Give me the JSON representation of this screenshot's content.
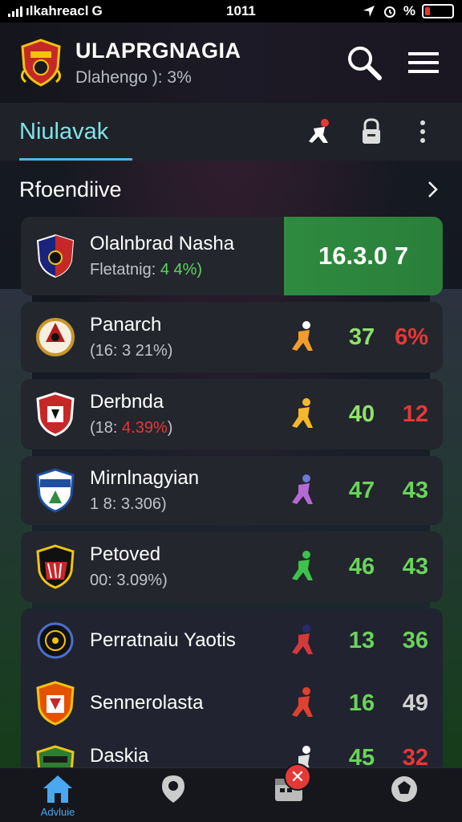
{
  "status_bar": {
    "carrier": "ılkahreacl",
    "network_icon": "G",
    "time": "1011",
    "battery_percent_text": "%",
    "battery_level": 0.2
  },
  "header": {
    "title": "ULAPRGNAGIA",
    "subtitle": "Dlahengo ): 3%",
    "icons": [
      "search-icon",
      "menu-icon"
    ]
  },
  "tab_bar": {
    "active_tab": "Niulavak",
    "icons": [
      "player-icon",
      "lock-icon",
      "more-icon"
    ]
  },
  "section": {
    "title": "Rfoendiive"
  },
  "featured": {
    "team": "Olalnbrad Nasha",
    "sub_label": "Fletatnig:",
    "sub_value": "4 4%)",
    "score": "16.3.0 7"
  },
  "teams": [
    {
      "name": "Panarch",
      "sub_pre": "(16: 3 21%)",
      "sub_hl": "",
      "sub_post": "",
      "stat_a": "37",
      "stat_b": "6%",
      "stat_a_color": "#8fe36a",
      "stat_b_color": "#e53935",
      "player_color": "#f39c2a"
    },
    {
      "name": "Derbnda",
      "sub_pre": "(18: ",
      "sub_hl": "4.39%",
      "sub_post": ")",
      "stat_a": "40",
      "stat_b": "12",
      "stat_a_color": "#8fe36a",
      "stat_b_color": "#e53935",
      "player_color": "#f5b82a"
    },
    {
      "name": "Mirnlnagyian",
      "sub_pre": "1 8: 3.306)",
      "sub_hl": "",
      "sub_post": "",
      "stat_a": "47",
      "stat_b": "43",
      "stat_a_color": "#6ad45a",
      "stat_b_color": "#6ad45a",
      "player_color": "#b46ad4"
    },
    {
      "name": "Petoved",
      "sub_pre": "00: 3.09%)",
      "sub_hl": "",
      "sub_post": "",
      "stat_a": "46",
      "stat_b": "43",
      "stat_a_color": "#6ad45a",
      "stat_b_color": "#6ad45a",
      "player_color": "#3ec24a"
    },
    {
      "name": "Perratnaiu Yaotis",
      "sub_pre": "",
      "sub_hl": "",
      "sub_post": "",
      "stat_a": "13",
      "stat_b": "36",
      "stat_a_color": "#6ad45a",
      "stat_b_color": "#6ad45a",
      "player_color": "#d43a3a"
    },
    {
      "name": "Sennerolasta",
      "sub_pre": "",
      "sub_hl": "",
      "sub_post": "",
      "stat_a": "16",
      "stat_b": "49",
      "stat_a_color": "#6ad45a",
      "stat_b_color": "#d0d0d0",
      "player_color": "#e04030"
    },
    {
      "name": "Daskia",
      "sub_pre": "",
      "sub_hl": "",
      "sub_post": "",
      "stat_a": "45",
      "stat_b": "32",
      "stat_a_color": "#6ad45a",
      "stat_b_color": "#e53935",
      "player_color": "#e0e0e0"
    }
  ],
  "bottom_nav": {
    "items": [
      {
        "icon": "home-icon",
        "label": "Advluie"
      },
      {
        "icon": "location-icon",
        "label": ""
      },
      {
        "icon": "calendar-icon",
        "label": ""
      },
      {
        "icon": "ball-icon",
        "label": ""
      }
    ],
    "notify_symbol": "✕"
  },
  "colors": {
    "accent": "#4fb6e8",
    "tab_text": "#7fe3e6",
    "positive": "#6ad45a",
    "negative": "#e53935",
    "featured_bg": "#2e8b3f"
  }
}
